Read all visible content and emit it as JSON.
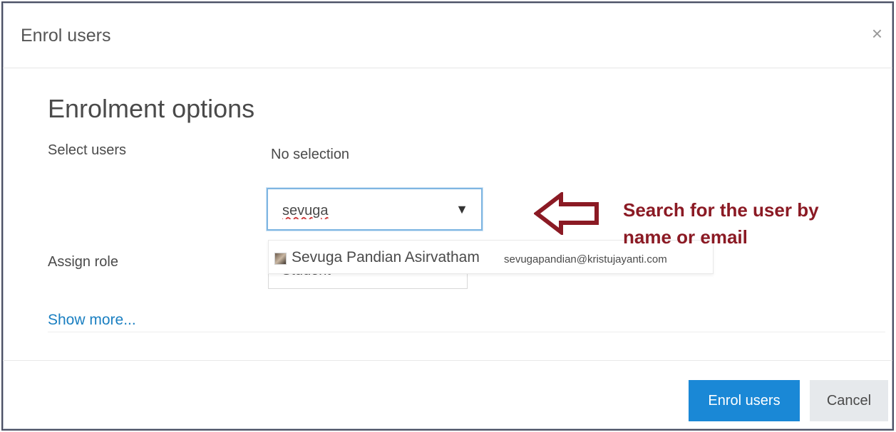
{
  "modal": {
    "title": "Enrol users",
    "close_glyph": "×"
  },
  "form": {
    "section_title": "Enrolment options",
    "select_users_label": "Select users",
    "selection_status": "No selection",
    "search_value": "sevuga",
    "dropdown_glyph": "▼",
    "assign_role_label": "Assign role",
    "role_value": "Student",
    "show_more": "Show more..."
  },
  "suggestions": [
    {
      "name": "Sevuga Pandian Asirvatham",
      "email": "sevugapandian@kristujayanti.com"
    }
  ],
  "annotation": {
    "text": "Search for the user by name or email",
    "color": "#8b1a24"
  },
  "footer": {
    "primary_label": "Enrol users",
    "secondary_label": "Cancel"
  },
  "colors": {
    "primary": "#1a88d6",
    "link": "#1a7fc1",
    "focus_border": "#7fb6e2"
  }
}
